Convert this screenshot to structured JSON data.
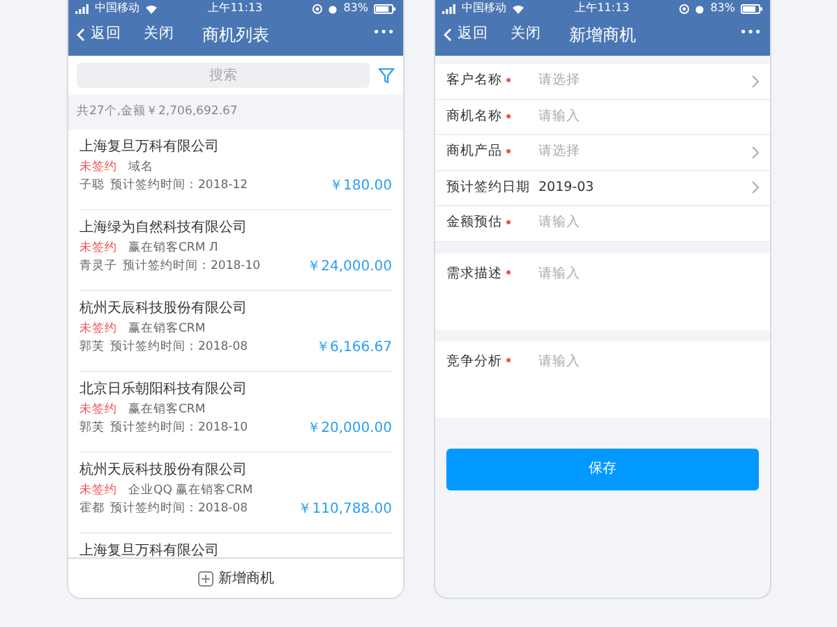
{
  "list_screen": {
    "status_bar": {
      "carrier": "中国移动",
      "time": "上午11:13",
      "battery": "83%"
    },
    "back": "返回",
    "close": "关闭",
    "title": "商机列表",
    "more": "•••",
    "search": {
      "placeholder": "搜索"
    },
    "summary": "共27个,金额￥2,706,692.67",
    "items": [
      {
        "company": "上海复旦万科有限公司",
        "status": "未签约",
        "tags": "域名",
        "owner": "子聪",
        "expected": "预计签约时间：2018-12",
        "amount": "￥180.00"
      },
      {
        "company": "上海绿为自然科技有限公司",
        "status": "未签约",
        "tags": "赢在销客CRM Л",
        "owner": "青灵子",
        "expected": "预计签约时间：2018-10",
        "amount": "￥24,000.00"
      },
      {
        "company": "杭州天辰科技股份有限公司",
        "status": "未签约",
        "tags": "赢在销客CRM",
        "owner": "郭芙",
        "expected": "预计签约时间：2018-08",
        "amount": "￥6,166.67"
      },
      {
        "company": "北京日乐朝阳科技有限公司",
        "status": "未签约",
        "tags": "赢在销客CRM",
        "owner": "郭芙",
        "expected": "预计签约时间：2018-10",
        "amount": "￥20,000.00"
      },
      {
        "company": "杭州天辰科技股份有限公司",
        "status": "未签约",
        "tags": "企业QQ 赢在销客CRM",
        "owner": "霍都",
        "expected": "预计签约时间：2018-08",
        "amount": "￥110,788.00"
      },
      {
        "company": "上海复旦万科有限公司"
      }
    ],
    "add_button": "新增商机"
  },
  "form_screen": {
    "status_bar": {
      "carrier": "中国移动",
      "time": "上午11:13",
      "battery": "83%"
    },
    "back": "返回",
    "close": "关闭",
    "title": "新增商机",
    "more": "•••",
    "fields": [
      {
        "kind": "select",
        "label": "客户名称",
        "required": true,
        "placeholder": "请选择"
      },
      {
        "kind": "input",
        "label": "商机名称",
        "required": true,
        "placeholder": "请输入"
      },
      {
        "kind": "select",
        "label": "商机产品",
        "required": true,
        "placeholder": "请选择"
      },
      {
        "kind": "select",
        "label": "预计签约日期",
        "required": false,
        "value": "2019-03"
      },
      {
        "kind": "input",
        "label": "金额预估",
        "required": true,
        "placeholder": "请输入"
      },
      {
        "kind": "textarea",
        "label": "需求描述",
        "required": true,
        "placeholder": "请输入"
      },
      {
        "kind": "textarea",
        "label": "竞争分析",
        "required": true,
        "placeholder": "请输入"
      }
    ],
    "save_button": "保存"
  }
}
